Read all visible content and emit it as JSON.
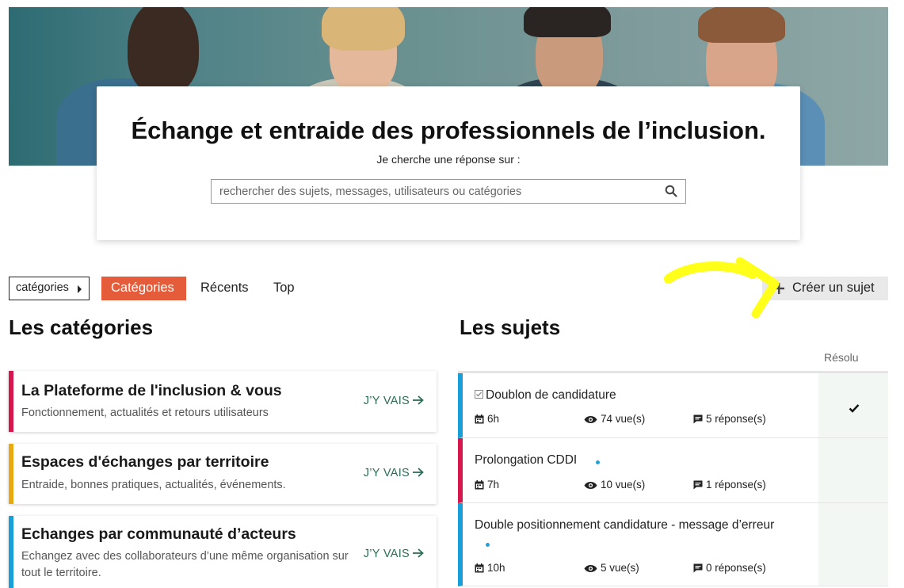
{
  "hero": {
    "title_prefix": "Échange et entraide ",
    "title_bold": "des professionnels de l’inclusion",
    "title_suffix": ".",
    "subtitle": "Je cherche une réponse sur :",
    "search_placeholder": "rechercher des sujets, messages, utilisateurs ou catégories"
  },
  "nav": {
    "dropdown_label": "catégories",
    "tabs": [
      {
        "label": "Catégories",
        "active": true
      },
      {
        "label": "Récents",
        "active": false
      },
      {
        "label": "Top",
        "active": false
      }
    ],
    "create_label": "Créer un sujet"
  },
  "categories": {
    "title": "Les catégories",
    "link_label": "J’Y VAIS",
    "items": [
      {
        "name": "La Plateforme de l'inclusion & vous",
        "description": "Fonctionnement, actualités et retours utilisateurs",
        "color": "#d6174d"
      },
      {
        "name": "Espaces d'échanges par territoire",
        "description": "Entraide, bonnes pratiques, actualités, événements.",
        "color": "#e8a811"
      },
      {
        "name": "Echanges par communauté d’acteurs",
        "description": "Echangez avec des collaborateurs d’une même organisation sur tout le territoire.",
        "color": "#199fd8"
      }
    ]
  },
  "topics": {
    "title": "Les sujets",
    "resolved_header": "Résolu",
    "items": [
      {
        "title": "Doublon de candidature",
        "solved": true,
        "time": "6h",
        "views": "74 vue(s)",
        "replies": "5 réponse(s)",
        "color": "#199fd8"
      },
      {
        "title": "Prolongation CDDI",
        "solved": false,
        "time": "7h",
        "views": "10 vue(s)",
        "replies": "1 réponse(s)",
        "color": "#d6174d"
      },
      {
        "title": "Double positionnement candidature - message d’erreur",
        "solved": false,
        "time": "10h",
        "views": "5 vue(s)",
        "replies": "0 réponse(s)",
        "color": "#199fd8"
      }
    ]
  },
  "icons": {
    "search": "search-icon",
    "plus": "plus-icon",
    "arrow": "arrow-right-icon",
    "calendar": "calendar-icon",
    "eye": "eye-icon",
    "comment": "comment-icon",
    "check": "check-icon"
  },
  "colors": {
    "accent": "#e45c3a",
    "link": "#2b6e55",
    "annotation": "#ffff1a"
  }
}
